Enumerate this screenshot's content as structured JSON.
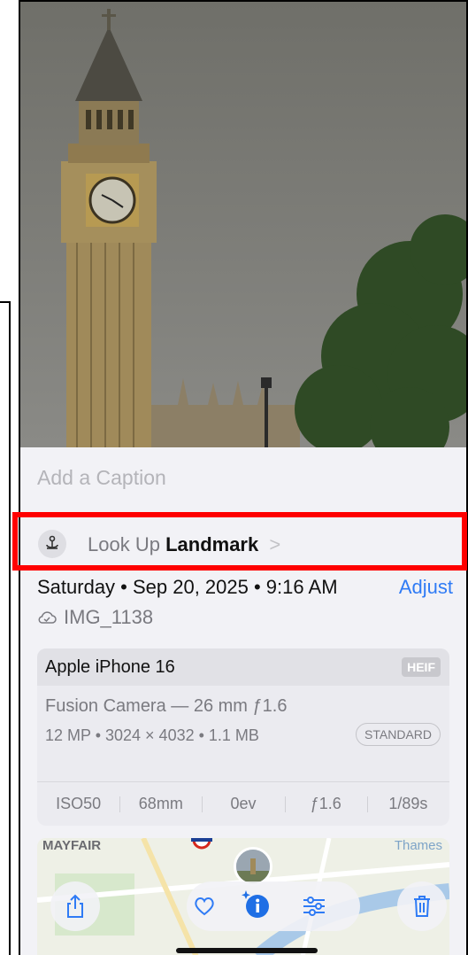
{
  "caption": {
    "placeholder": "Add a Caption"
  },
  "lookup": {
    "prefix": "Look Up",
    "subject": "Landmark",
    "chevron": ">"
  },
  "info": {
    "date": "Saturday • Sep 20, 2025 • 9:16 AM",
    "adjust_label": "Adjust",
    "filename": "IMG_1138",
    "device": "Apple iPhone 16",
    "format": "HEIF",
    "lens": "Fusion Camera — 26 mm ƒ1.6",
    "specs": "12 MP • 3024 × 4032 • 1.1 MB",
    "mode": "STANDARD",
    "exif": [
      "ISO50",
      "68mm",
      "0ev",
      "ƒ1.6",
      "1/89s"
    ]
  },
  "map": {
    "label_left": "MAYFAIR",
    "label_right": "Thames"
  },
  "toolbar": {
    "icons": [
      "share-icon",
      "heart-icon",
      "info-sparkle-icon",
      "adjust-sliders-icon",
      "trash-icon"
    ]
  },
  "colors": {
    "accent": "#2f7bf5",
    "highlight": "#ff0000",
    "info_icon": "#1f6fe5"
  }
}
